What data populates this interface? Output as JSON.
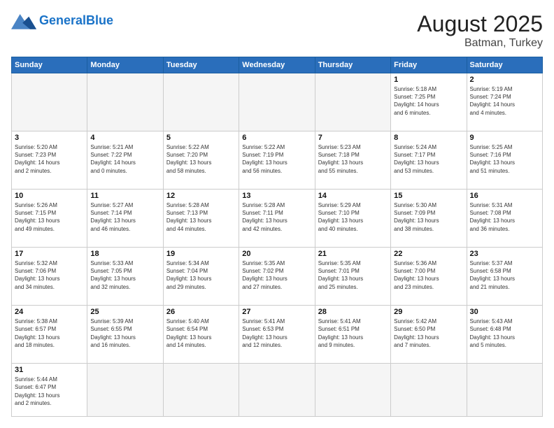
{
  "header": {
    "logo_general": "General",
    "logo_blue": "Blue",
    "title": "August 2025",
    "subtitle": "Batman, Turkey"
  },
  "weekdays": [
    "Sunday",
    "Monday",
    "Tuesday",
    "Wednesday",
    "Thursday",
    "Friday",
    "Saturday"
  ],
  "weeks": [
    [
      {
        "day": "",
        "info": "",
        "empty": true
      },
      {
        "day": "",
        "info": "",
        "empty": true
      },
      {
        "day": "",
        "info": "",
        "empty": true
      },
      {
        "day": "",
        "info": "",
        "empty": true
      },
      {
        "day": "",
        "info": "",
        "empty": true
      },
      {
        "day": "1",
        "info": "Sunrise: 5:18 AM\nSunset: 7:25 PM\nDaylight: 14 hours\nand 6 minutes."
      },
      {
        "day": "2",
        "info": "Sunrise: 5:19 AM\nSunset: 7:24 PM\nDaylight: 14 hours\nand 4 minutes."
      }
    ],
    [
      {
        "day": "3",
        "info": "Sunrise: 5:20 AM\nSunset: 7:23 PM\nDaylight: 14 hours\nand 2 minutes."
      },
      {
        "day": "4",
        "info": "Sunrise: 5:21 AM\nSunset: 7:22 PM\nDaylight: 14 hours\nand 0 minutes."
      },
      {
        "day": "5",
        "info": "Sunrise: 5:22 AM\nSunset: 7:20 PM\nDaylight: 13 hours\nand 58 minutes."
      },
      {
        "day": "6",
        "info": "Sunrise: 5:22 AM\nSunset: 7:19 PM\nDaylight: 13 hours\nand 56 minutes."
      },
      {
        "day": "7",
        "info": "Sunrise: 5:23 AM\nSunset: 7:18 PM\nDaylight: 13 hours\nand 55 minutes."
      },
      {
        "day": "8",
        "info": "Sunrise: 5:24 AM\nSunset: 7:17 PM\nDaylight: 13 hours\nand 53 minutes."
      },
      {
        "day": "9",
        "info": "Sunrise: 5:25 AM\nSunset: 7:16 PM\nDaylight: 13 hours\nand 51 minutes."
      }
    ],
    [
      {
        "day": "10",
        "info": "Sunrise: 5:26 AM\nSunset: 7:15 PM\nDaylight: 13 hours\nand 49 minutes."
      },
      {
        "day": "11",
        "info": "Sunrise: 5:27 AM\nSunset: 7:14 PM\nDaylight: 13 hours\nand 46 minutes."
      },
      {
        "day": "12",
        "info": "Sunrise: 5:28 AM\nSunset: 7:13 PM\nDaylight: 13 hours\nand 44 minutes."
      },
      {
        "day": "13",
        "info": "Sunrise: 5:28 AM\nSunset: 7:11 PM\nDaylight: 13 hours\nand 42 minutes."
      },
      {
        "day": "14",
        "info": "Sunrise: 5:29 AM\nSunset: 7:10 PM\nDaylight: 13 hours\nand 40 minutes."
      },
      {
        "day": "15",
        "info": "Sunrise: 5:30 AM\nSunset: 7:09 PM\nDaylight: 13 hours\nand 38 minutes."
      },
      {
        "day": "16",
        "info": "Sunrise: 5:31 AM\nSunset: 7:08 PM\nDaylight: 13 hours\nand 36 minutes."
      }
    ],
    [
      {
        "day": "17",
        "info": "Sunrise: 5:32 AM\nSunset: 7:06 PM\nDaylight: 13 hours\nand 34 minutes."
      },
      {
        "day": "18",
        "info": "Sunrise: 5:33 AM\nSunset: 7:05 PM\nDaylight: 13 hours\nand 32 minutes."
      },
      {
        "day": "19",
        "info": "Sunrise: 5:34 AM\nSunset: 7:04 PM\nDaylight: 13 hours\nand 29 minutes."
      },
      {
        "day": "20",
        "info": "Sunrise: 5:35 AM\nSunset: 7:02 PM\nDaylight: 13 hours\nand 27 minutes."
      },
      {
        "day": "21",
        "info": "Sunrise: 5:35 AM\nSunset: 7:01 PM\nDaylight: 13 hours\nand 25 minutes."
      },
      {
        "day": "22",
        "info": "Sunrise: 5:36 AM\nSunset: 7:00 PM\nDaylight: 13 hours\nand 23 minutes."
      },
      {
        "day": "23",
        "info": "Sunrise: 5:37 AM\nSunset: 6:58 PM\nDaylight: 13 hours\nand 21 minutes."
      }
    ],
    [
      {
        "day": "24",
        "info": "Sunrise: 5:38 AM\nSunset: 6:57 PM\nDaylight: 13 hours\nand 18 minutes."
      },
      {
        "day": "25",
        "info": "Sunrise: 5:39 AM\nSunset: 6:55 PM\nDaylight: 13 hours\nand 16 minutes."
      },
      {
        "day": "26",
        "info": "Sunrise: 5:40 AM\nSunset: 6:54 PM\nDaylight: 13 hours\nand 14 minutes."
      },
      {
        "day": "27",
        "info": "Sunrise: 5:41 AM\nSunset: 6:53 PM\nDaylight: 13 hours\nand 12 minutes."
      },
      {
        "day": "28",
        "info": "Sunrise: 5:41 AM\nSunset: 6:51 PM\nDaylight: 13 hours\nand 9 minutes."
      },
      {
        "day": "29",
        "info": "Sunrise: 5:42 AM\nSunset: 6:50 PM\nDaylight: 13 hours\nand 7 minutes."
      },
      {
        "day": "30",
        "info": "Sunrise: 5:43 AM\nSunset: 6:48 PM\nDaylight: 13 hours\nand 5 minutes."
      }
    ],
    [
      {
        "day": "31",
        "info": "Sunrise: 5:44 AM\nSunset: 6:47 PM\nDaylight: 13 hours\nand 2 minutes.",
        "last": true
      },
      {
        "day": "",
        "info": "",
        "empty": true,
        "last": true
      },
      {
        "day": "",
        "info": "",
        "empty": true,
        "last": true
      },
      {
        "day": "",
        "info": "",
        "empty": true,
        "last": true
      },
      {
        "day": "",
        "info": "",
        "empty": true,
        "last": true
      },
      {
        "day": "",
        "info": "",
        "empty": true,
        "last": true
      },
      {
        "day": "",
        "info": "",
        "empty": true,
        "last": true
      }
    ]
  ]
}
